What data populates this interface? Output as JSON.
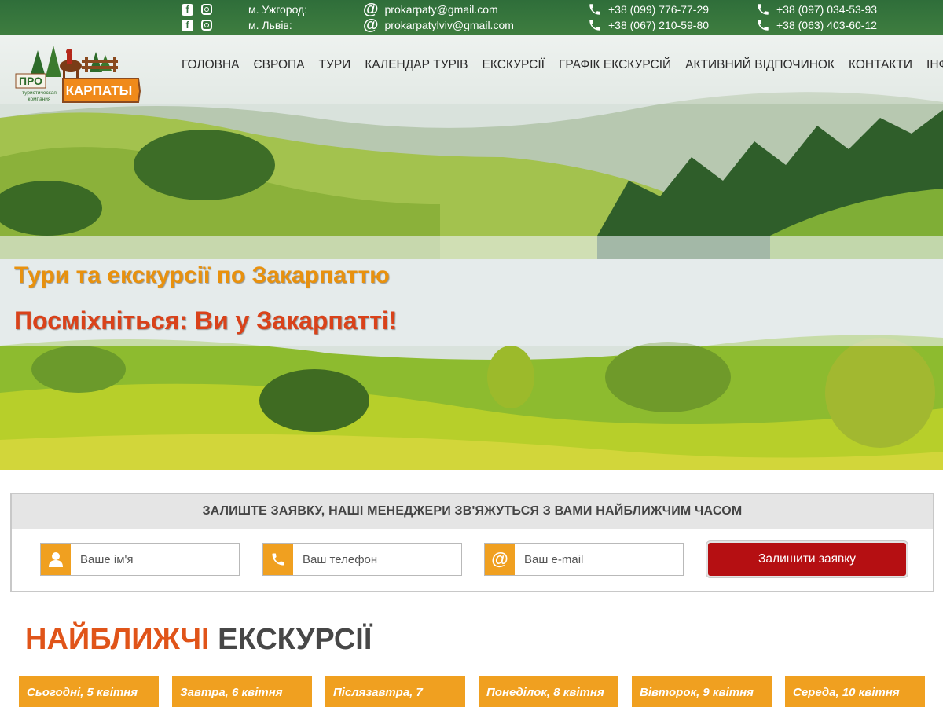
{
  "topbar": {
    "social": [
      "facebook-icon",
      "instagram-icon"
    ],
    "cities": [
      "м. Ужгород:",
      "м. Львів:"
    ],
    "emails": [
      "prokarpaty@gmail.com",
      "prokarpatylviv@gmail.com"
    ],
    "phones_col1": [
      "+38 (099) 776-77-29",
      "+38 (067) 210-59-80"
    ],
    "phones_col2": [
      "+38 (097) 034-53-93",
      "+38 (063) 403-60-12"
    ]
  },
  "logo": {
    "text_top": "ПРО",
    "text_main": "КАРПАТЫ",
    "subtitle_1": "туристическая",
    "subtitle_2": "компания"
  },
  "nav": [
    "ГОЛОВНА",
    "ЄВРОПА",
    "ТУРИ",
    "КАЛЕНДАР ТУРІВ",
    "ЕКСКУРСІЇ",
    "ГРАФІК ЕКСКУРСІЙ",
    "АКТИВНИЙ ВІДПОЧИНОК",
    "КОНТАКТИ",
    "ІНФО"
  ],
  "hero": {
    "tagline_1": "Тури та екскурсії по Закарпаттю",
    "tagline_2": "Посміхніться: Ви у Закарпатті!"
  },
  "request": {
    "heading": "ЗАЛИШТЕ ЗАЯВКУ, НАШІ МЕНЕДЖЕРИ ЗВ'ЯЖУТЬСЯ З ВАМИ НАЙБЛИЖЧИМ ЧАСОМ",
    "name_placeholder": "Ваше ім'я",
    "phone_placeholder": "Ваш телефон",
    "email_placeholder": "Ваш e-mail",
    "submit_label": "Залишити заявку"
  },
  "excursions": {
    "title_accent": "НАЙБЛИЖЧІ",
    "title_rest": "ЕКСКУРСІЇ",
    "days": [
      "Сьогодні, 5 квітня",
      "Завтра, 6 квітня",
      "Післязавтра, 7",
      "Понеділок, 8 квітня",
      "Вівторок, 9 квітня",
      "Середа, 10 квітня"
    ]
  },
  "colors": {
    "accent_orange": "#f0a020",
    "accent_red": "#e05419",
    "button_red": "#b50f12",
    "topbar_green": "#2f6e3a"
  }
}
